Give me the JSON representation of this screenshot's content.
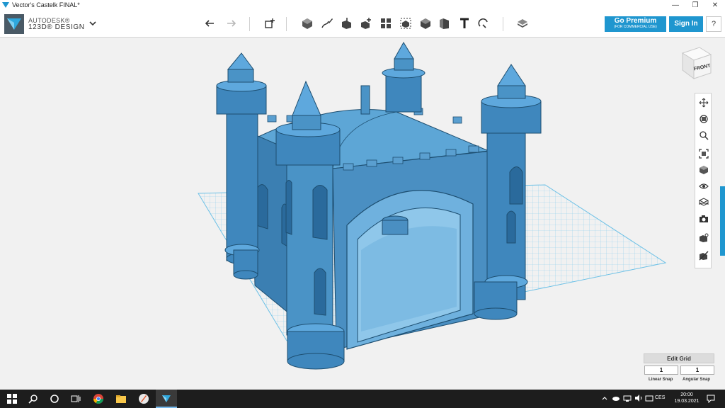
{
  "window": {
    "title": "Vector's Castelk FINAL*"
  },
  "app": {
    "brand": "AUTODESK®",
    "product": "123D® DESIGN"
  },
  "toolbar": {
    "buttons": [
      "undo-icon",
      "redo-icon",
      "primitives-icon",
      "box-icon",
      "sketch-icon",
      "construct-icon",
      "modify-icon",
      "pattern-icon",
      "group-icon",
      "combine-icon",
      "measure-icon",
      "text-icon",
      "snap-icon",
      "material-icon"
    ]
  },
  "account": {
    "premium_label": "Go Premium",
    "premium_sub": "(FOR COMMERCIAL USE)",
    "signin_label": "Sign In",
    "help_label": "?"
  },
  "viewcube": {
    "face_label": "FRONT"
  },
  "nav": {
    "buttons": [
      "pan-icon",
      "orbit-icon",
      "zoom-icon",
      "fit-icon",
      "view-icon",
      "visibility-icon",
      "material-display-icon",
      "screenshot-icon",
      "hide-icon",
      "grid-toggle-icon"
    ]
  },
  "grid": {
    "edit_label": "Edit Grid",
    "linear_value": "1",
    "angular_value": "1",
    "linear_label": "Linear Snap",
    "angular_label": "Angular Snap"
  },
  "taskbar": {
    "time": "20:00",
    "date": "19.03.2021",
    "language": "CES"
  },
  "colors": {
    "accent": "#1f96cf",
    "model": "#3b87be",
    "grid": "#8fd0ec"
  }
}
